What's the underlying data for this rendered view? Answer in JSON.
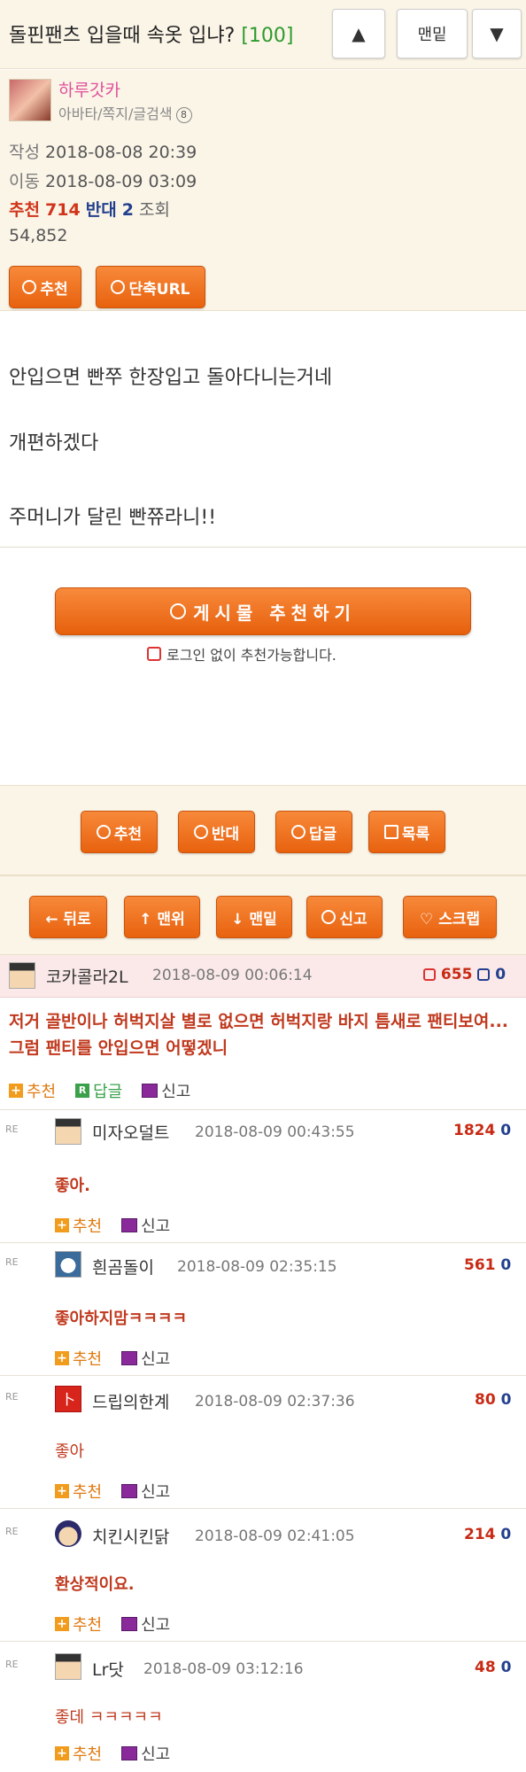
{
  "header": {
    "title": "돌핀팬츠 입을때 속옷 입냐?",
    "count": "[100]",
    "up_icon": "▲",
    "bottom_label": "맨밑",
    "down_icon": "▼"
  },
  "author": {
    "name": "하루갓카",
    "links": "아바타/쪽지/글검색",
    "level": "8",
    "written_label": "작성",
    "written": "2018-08-08 20:39",
    "moved_label": "이동",
    "moved": "2018-08-09 03:09",
    "up_label": "추천",
    "up": "714",
    "down_label": "반대",
    "down": "2",
    "views_label": "조회",
    "views": "54,852",
    "btn_reco": "추천",
    "btn_url": "단축URL"
  },
  "post": {
    "lines": [
      "안입으면 빤쭈 한장입고 돌아다니는거네",
      "개편하겠다",
      "주머니가 달린 빤쮸라니!!"
    ]
  },
  "recommend": {
    "button": "게시물 추천하기",
    "note": "로그인 없이 추천가능합니다."
  },
  "actions1": [
    "추천",
    "반대",
    "답글",
    "목록"
  ],
  "actions2": [
    "← 뒤로",
    "↑ 맨위",
    "↓ 맨밑",
    "신고",
    "♡ 스크랩"
  ],
  "comment_top": {
    "name": "코카콜라2L",
    "date": "2018-08-09 00:06:14",
    "up": "655",
    "down": "0",
    "text": "저거 골반이나 허벅지살 별로 없으면 허벅지랑 바지 틈새로 팬티보여...그럼 팬티를 안입으면 어떻겠니",
    "reco": "추천",
    "reply": "답글",
    "report": "신고"
  },
  "replies": [
    {
      "name": "미자오덜트",
      "date": "2018-08-09 00:43:55",
      "score": "1824",
      "zero": "0",
      "text": "좋아."
    },
    {
      "name": "흰곰돌이",
      "date": "2018-08-09 02:35:15",
      "score": "561",
      "zero": "0",
      "text": "좋아하지맘ㅋㅋㅋㅋ"
    },
    {
      "name": "드립의한계",
      "date": "2018-08-09 02:37:36",
      "score": "80",
      "zero": "0",
      "text": "좋아"
    },
    {
      "name": "치킨시킨닭",
      "date": "2018-08-09 02:41:05",
      "score": "214",
      "zero": "0",
      "text": "환상적이요."
    },
    {
      "name": "Lr닷",
      "date": "2018-08-09 03:12:16",
      "score": "48",
      "zero": "0",
      "text": "좋데 ㅋㅋㅋㅋㅋ"
    }
  ],
  "reply_actions": {
    "reco": "추천",
    "report": "신고",
    "re": "RE"
  }
}
